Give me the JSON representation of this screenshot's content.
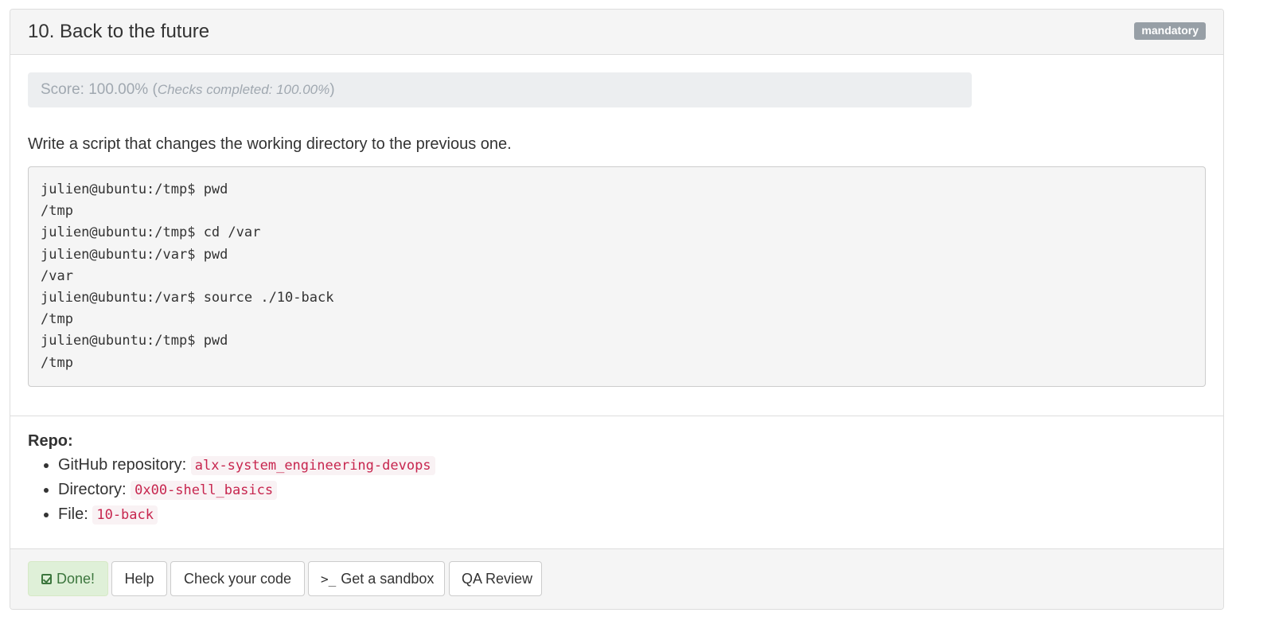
{
  "task": {
    "title": "10. Back to the future",
    "badge": "mandatory",
    "score": {
      "label": "Score: 100.00%",
      "open_paren": " (",
      "checks": "Checks completed: 100.00%",
      "close_paren": ")"
    },
    "description": "Write a script that changes the working directory to the previous one.",
    "code_lines": [
      "julien@ubuntu:/tmp$ pwd",
      "/tmp",
      "julien@ubuntu:/tmp$ cd /var",
      "julien@ubuntu:/var$ pwd",
      "/var",
      "julien@ubuntu:/var$ source ./10-back",
      "/tmp",
      "julien@ubuntu:/tmp$ pwd",
      "/tmp"
    ],
    "repo": {
      "title": "Repo:",
      "items": [
        {
          "label": "GitHub repository: ",
          "value": "alx-system_engineering-devops"
        },
        {
          "label": "Directory: ",
          "value": "0x00-shell_basics"
        },
        {
          "label": "File: ",
          "value": "10-back"
        }
      ]
    },
    "footer": {
      "done_label": "Done!",
      "help_label": "Help",
      "check_label": "Check your code",
      "sandbox_icon": ">_",
      "sandbox_label": "Get a sandbox",
      "qa_label": "QA Review"
    }
  },
  "colors": {
    "badge_bg": "#979fa6",
    "score_bg": "#eceef0",
    "inline_code": "#c7254e",
    "done_bg": "#dff0d8",
    "done_text": "#3c763d"
  },
  "icons": {
    "done": "check-square-icon",
    "sandbox": "terminal-icon"
  }
}
